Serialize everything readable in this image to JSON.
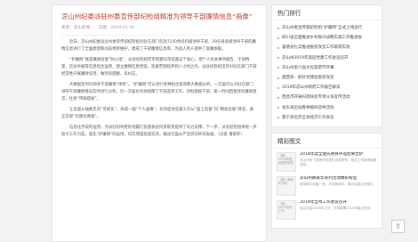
{
  "article": {
    "title": "凉山州纪委派驻州委宣传部纪检组精准为领导干部廉情信息“画像”",
    "meta": {
      "source": "来源：凉山新闻",
      "date": "日期：2019-01-30"
    },
    "paragraphs": [
      "近日，凉山州纪委派驻州委宣传部纪检组对驻在部门包括7150余名科级领导干部、29名县处级领导干部的廉情信息进行了全面梳理和动态更新维护，建成了干部廉情信息库，为选人用人提供了准确依据。",
      "“护廉网”既是廉政监督“防火墙”，派驻纪检组牢牢把握日常监督这个核心，把个人有关事项报告、干部档案、信访举报等信息综合运用，建立廉情信息档案，监督范围延伸到八小时之外。派驻纪检组坚持对驻在部门干部经常性开展廉政谈话，做到早提醒、早纠正。",
      "大数据及时对领导干部廉情“体检”。“护廉网”可以进行各种组合查询和大数据分析，一方面可以对驻在部门领导干部廉情情况实时进行分析，另一方面也有效保障了干部选用工作，对拟提拔干部，第一时间回复党风廉政意见，杜绝“带病提拔”。",
      "让监督从抽象走向“可视化”，形成一幅“个人画像”，有效促进监督工作从“面上监督”向“精准监督”转变，真正实现“有图有真相”。",
      "信息化手段的运用，为派驻机构更好地履行监督执纪问责职责提供了有力支撑。下一步，派驻纪检组将进一步加大工作力度，强化“护廉网”的运用，切实增强监督实效，推动全面从严治党向纵深发展。（记者 潘家轩）"
    ]
  },
  "sidebar": {
    "hot_title": "热门排行",
    "hot_items": [
      "凉山州委宣传部纪检组“护廉网”正式上线运行",
      "四川省全面推进乡村振兴战略实施工作推进会",
      "喜德县扎实推进脱贫攻坚工作取得实效",
      "凉山州2019年基层党建工作会议召开",
      "凉山州第六届文化旅游节开幕",
      "越西县：抓好党建促脱贫攻坚",
      "2019年凉山州政府工作报告解读",
      "西昌市开展扫黑除恶专项斗争宣传活动",
      "会东县启动春季植树造林活动",
      "冕宁县召开全县经济工作会议"
    ],
    "pic_title": "精彩图文",
    "pic_items": [
      {
        "thumb": "（图）2018年度全国先进县",
        "title": "2018年度全国先进县评选结果出炉",
        "desc": "凉山州多个县荣获全国先进县称号，相关工作取得显著成效。"
      },
      {
        "thumb": "（图）彝族年活动",
        "title": "凉山州彝族年系列活动精彩纷呈",
        "desc": "各地群众欢聚一堂，共庆彝族年，展示民族文化魅力。"
      },
      {
        "thumb": "（图）2019全州工作",
        "title": "2019年全州工作会议召开",
        "desc": "会议总结2018年工作，安排部署2019年重点任务。"
      }
    ]
  },
  "back_to_top": "⇧"
}
